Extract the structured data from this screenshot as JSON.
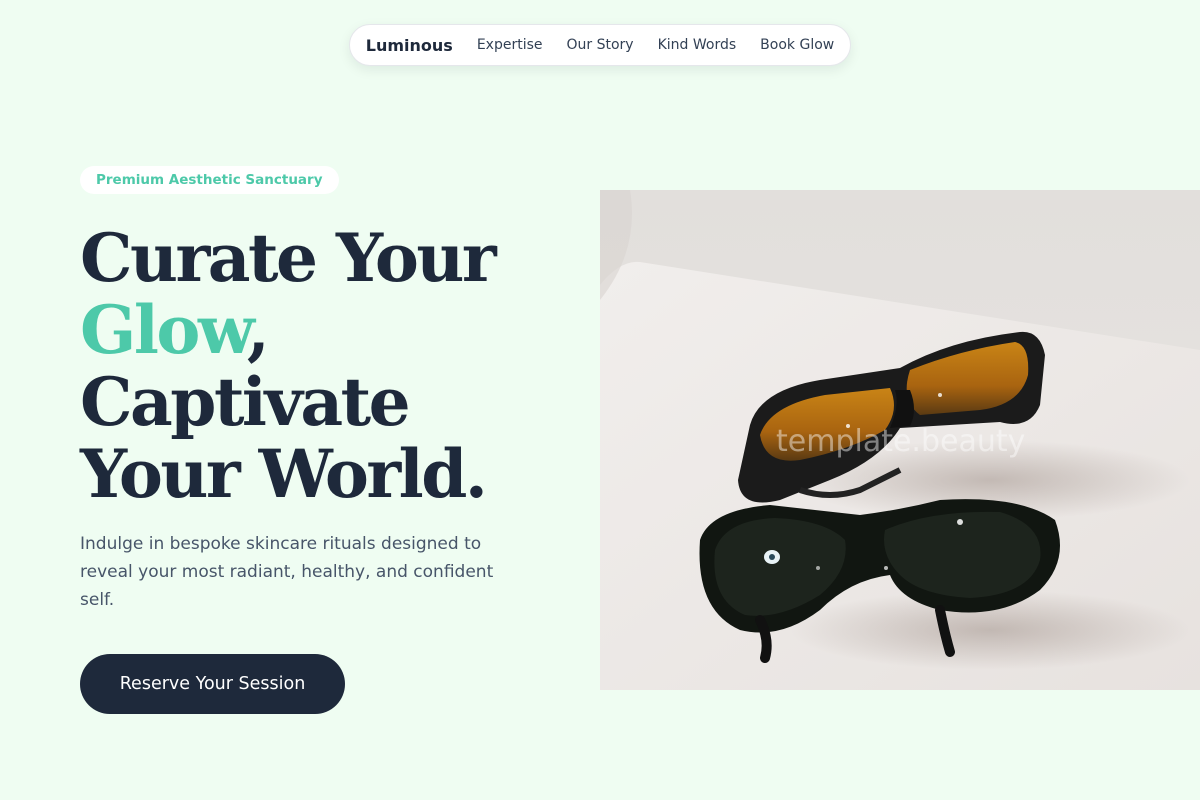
{
  "nav": {
    "brand": "Luminous",
    "links": [
      "Expertise",
      "Our Story",
      "Kind Words",
      "Book Glow"
    ]
  },
  "hero": {
    "badge": "Premium Aesthetic Sanctuary",
    "headline": {
      "line1": "Curate Your",
      "accent": "Glow",
      "accent_suffix": ",",
      "line3": "Captivate",
      "line4": "Your World."
    },
    "description": "Indulge in bespoke skincare rituals designed to reveal your most radiant, healthy, and confident self.",
    "cta_label": "Reserve Your Session"
  },
  "image": {
    "watermark": "template.beauty",
    "subject": "two pairs of protective tinted eyewear on a white surface"
  },
  "colors": {
    "background": "#effdf2",
    "accent": "#4dc9a9",
    "dark": "#1e293b",
    "body_text": "#475569"
  }
}
